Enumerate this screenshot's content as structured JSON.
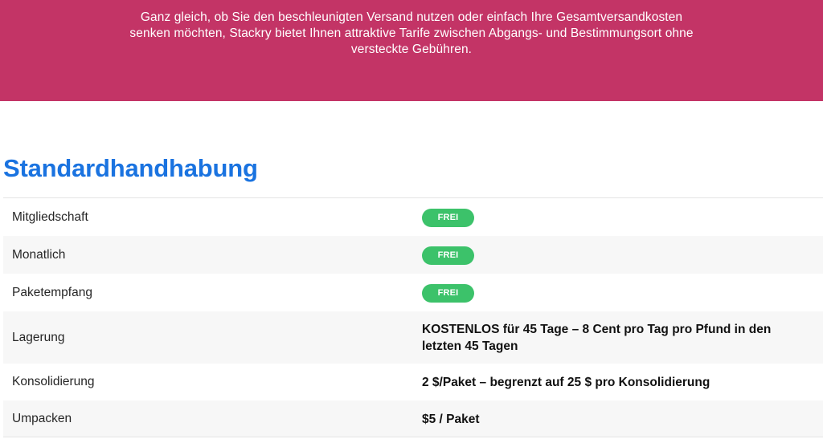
{
  "banner": {
    "text": "Ganz gleich, ob Sie den beschleunigten Versand nutzen oder einfach Ihre Gesamtversandkosten senken möchten, Stackry bietet Ihnen attraktive Tarife zwischen Abgangs- und Bestimmungsort ohne versteckte Gebühren.",
    "background_color": "#c33466"
  },
  "section": {
    "title": "Standardhandhabung",
    "title_color": "#1a73e0"
  },
  "badge_color": "#3cc26a",
  "rows": [
    {
      "label": "Mitgliedschaft",
      "type": "badge",
      "value": "FREI"
    },
    {
      "label": "Monatlich",
      "type": "badge",
      "value": "FREI"
    },
    {
      "label": "Paketempfang",
      "type": "badge",
      "value": "FREI"
    },
    {
      "label": "Lagerung",
      "type": "text",
      "value": "KOSTENLOS für 45 Tage – 8 Cent pro Tag pro Pfund in den letzten 45 Tagen"
    },
    {
      "label": "Konsolidierung",
      "type": "text",
      "value": "2 $/Paket – begrenzt auf 25 $ pro Konsolidierung"
    },
    {
      "label": "Umpacken",
      "type": "text",
      "value": "$5 / Paket"
    }
  ]
}
